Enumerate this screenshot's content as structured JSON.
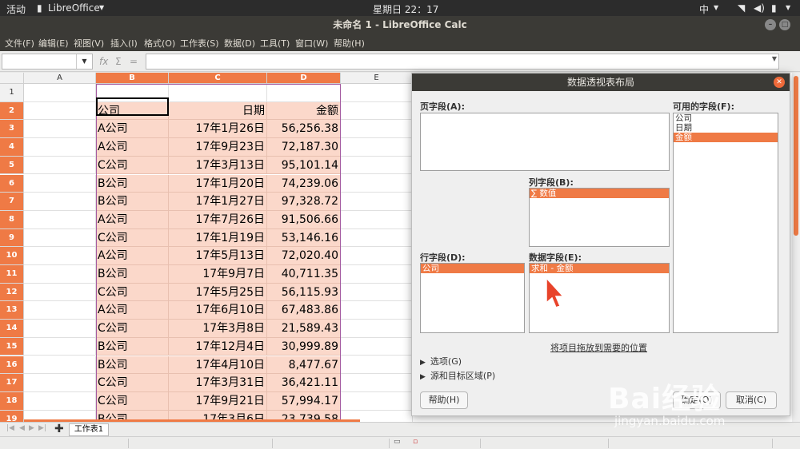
{
  "system": {
    "activities": "活动",
    "app_menu": "LibreOffice",
    "clock": "星期日 22：17",
    "input_method": "中"
  },
  "window": {
    "title": "未命名 1 - LibreOffice Calc"
  },
  "menubar": {
    "items": [
      "文件(F)",
      "编辑(E)",
      "视图(V)",
      "插入(I)",
      "格式(O)",
      "工作表(S)",
      "数据(D)",
      "工具(T)",
      "窗口(W)",
      "帮助(H)"
    ]
  },
  "formula": {
    "namebox": "",
    "input": "",
    "fx": "fx",
    "sigma": "Σ",
    "equals": "="
  },
  "sheet": {
    "columns": [
      "A",
      "B",
      "C",
      "D",
      "E"
    ],
    "rows": [
      {
        "n": "1",
        "b": "",
        "c": "",
        "d": ""
      },
      {
        "n": "2",
        "b": "公司",
        "c": "日期",
        "d": "金额"
      },
      {
        "n": "3",
        "b": "A公司",
        "c": "17年1月26日",
        "d": "56,256.38"
      },
      {
        "n": "4",
        "b": "A公司",
        "c": "17年9月23日",
        "d": "72,187.30"
      },
      {
        "n": "5",
        "b": "C公司",
        "c": "17年3月13日",
        "d": "95,101.14"
      },
      {
        "n": "6",
        "b": "B公司",
        "c": "17年1月20日",
        "d": "74,239.06"
      },
      {
        "n": "7",
        "b": "B公司",
        "c": "17年1月27日",
        "d": "97,328.72"
      },
      {
        "n": "8",
        "b": "A公司",
        "c": "17年7月26日",
        "d": "91,506.66"
      },
      {
        "n": "9",
        "b": "C公司",
        "c": "17年1月19日",
        "d": "53,146.16"
      },
      {
        "n": "10",
        "b": "A公司",
        "c": "17年5月13日",
        "d": "72,020.40"
      },
      {
        "n": "11",
        "b": "B公司",
        "c": "17年9月7日",
        "d": "40,711.35"
      },
      {
        "n": "12",
        "b": "C公司",
        "c": "17年5月25日",
        "d": "56,115.93"
      },
      {
        "n": "13",
        "b": "A公司",
        "c": "17年6月10日",
        "d": "67,483.86"
      },
      {
        "n": "14",
        "b": "C公司",
        "c": "17年3月8日",
        "d": "21,589.43"
      },
      {
        "n": "15",
        "b": "B公司",
        "c": "17年12月4日",
        "d": "30,999.89"
      },
      {
        "n": "16",
        "b": "B公司",
        "c": "17年4月10日",
        "d": "8,477.67"
      },
      {
        "n": "17",
        "b": "C公司",
        "c": "17年3月31日",
        "d": "36,421.11"
      },
      {
        "n": "18",
        "b": "C公司",
        "c": "17年9月21日",
        "d": "57,994.17"
      },
      {
        "n": "19",
        "b": "B公司",
        "c": "17年3月6日",
        "d": "23,739.58"
      }
    ],
    "tab_name": "工作表1"
  },
  "dialog": {
    "title": "数据透视表布局",
    "page_fields_label": "页字段(A):",
    "column_fields_label": "列字段(B):",
    "column_fields": [
      "∑ 数值"
    ],
    "row_fields_label": "行字段(D):",
    "row_fields": [
      "公司"
    ],
    "data_fields_label": "数据字段(E):",
    "data_fields": [
      "求和 - 金额"
    ],
    "available_fields_label": "可用的字段(F):",
    "available_fields": [
      "公司",
      "日期",
      "金额"
    ],
    "available_selected": 2,
    "hint": "将项目拖放到需要的位置",
    "options_label": "选项(G)",
    "source_label": "源和目标区域(P)",
    "help_button": "帮助(H)",
    "ok_button": "确定(O)",
    "cancel_button": "取消(C)"
  },
  "watermark": {
    "logo": "Bai经验",
    "url": "jingyan.baidu.com"
  },
  "colors": {
    "accent": "#ef7a45",
    "highlight": "#fbd8ca",
    "titlebar": "#3b3a36"
  }
}
